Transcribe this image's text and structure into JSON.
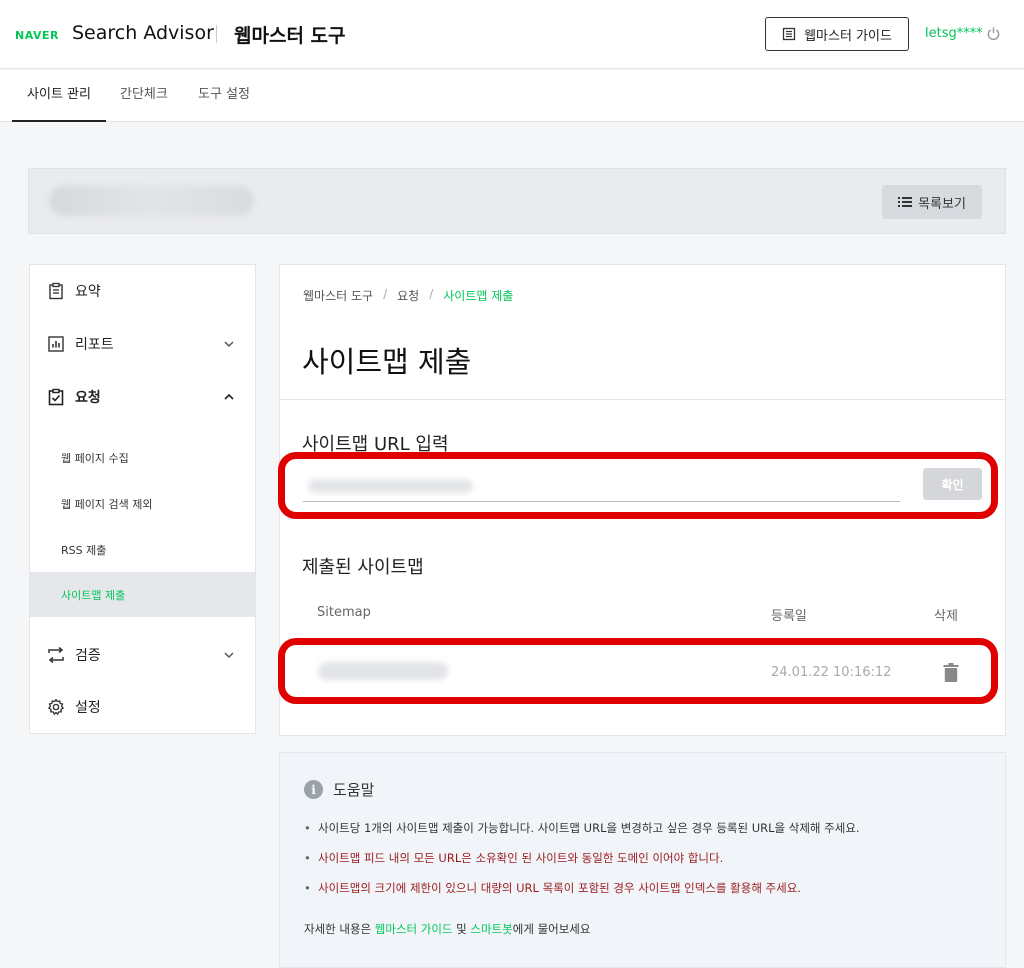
{
  "header": {
    "brand_naver": "NAVER",
    "brand_product": "Search Advisor",
    "tool_title": "웹마스터 도구",
    "guide_button": "웹마스터 가이드",
    "user_id": "letsg****",
    "accent_color": "#03c75a"
  },
  "tabs": [
    {
      "label": "사이트 관리",
      "active": true
    },
    {
      "label": "간단체크",
      "active": false
    },
    {
      "label": "도구 설정",
      "active": false
    }
  ],
  "site_bar": {
    "list_button": "목록보기"
  },
  "sidebar": {
    "items": [
      {
        "label": "요약",
        "icon": "clipboard-icon"
      },
      {
        "label": "리포트",
        "icon": "chart-icon",
        "expanded": false
      },
      {
        "label": "요청",
        "icon": "clipboard-check-icon",
        "expanded": true
      },
      {
        "label": "검증",
        "icon": "swap-arrows-icon",
        "expanded": false
      },
      {
        "label": "설정",
        "icon": "gear-icon"
      }
    ],
    "sub_items": [
      {
        "label": "웹 페이지 수집",
        "active": false
      },
      {
        "label": "웹 페이지 검색 제외",
        "active": false
      },
      {
        "label": "RSS 제출",
        "active": false
      },
      {
        "label": "사이트맵 제출",
        "active": true
      }
    ]
  },
  "main": {
    "breadcrumb": [
      "웹마스터 도구",
      "요청",
      "사이트맵 제출"
    ],
    "title": "사이트맵 제출",
    "url_section_label": "사이트맵 URL 입력",
    "confirm_button": "확인",
    "submitted_label": "제출된 사이트맵",
    "table_headers": {
      "sitemap": "Sitemap",
      "date": "등록일",
      "delete": "삭제"
    },
    "rows": [
      {
        "date": "24.01.22 10:16:12"
      }
    ]
  },
  "help": {
    "title": "도움말",
    "items": [
      {
        "text": "사이트당 1개의 사이트맵 제출이 가능합니다. 사이트맵 URL을 변경하고 싶은 경우 등록된 URL을 삭제해 주세요.",
        "tone": "normal"
      },
      {
        "text": "사이트맵 피드 내의 모든 URL은 소유확인 된 사이트와 동일한 도메인 이어야 합니다.",
        "tone": "warn"
      },
      {
        "text": "사이트맵의 크기에 제한이 있으니 대량의 URL 목록이 포함된 경우 사이트맵 인덱스를 활용해 주세요.",
        "tone": "warn"
      }
    ],
    "footer_prefix": "자세한 내용은",
    "footer_link1": "웹마스터 가이드",
    "footer_and": "및",
    "footer_link2": "스마트봇",
    "footer_suffix": "에게 물어보세요"
  }
}
